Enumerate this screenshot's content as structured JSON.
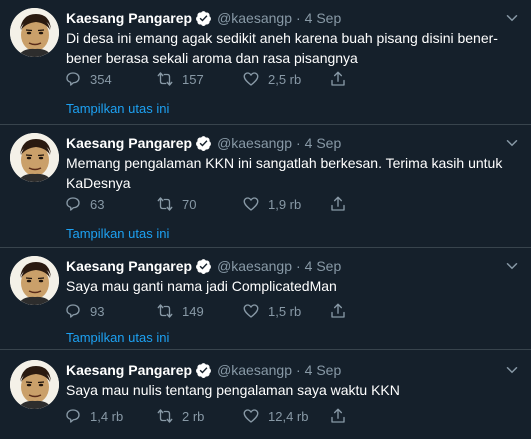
{
  "colors": {
    "background": "#15202b",
    "divider": "#38444d",
    "secondary_text": "#8899a6",
    "accent": "#1da1f2"
  },
  "tweets": [
    {
      "author": "Kaesang Pangarep",
      "handle": "@kaesangp",
      "separator": "·",
      "date": "4 Sep",
      "text": "Di desa ini emang agak sedikit aneh karena buah pisang disini bener-bener berasa sekali aroma dan rasa pisangnya",
      "replies": "354",
      "retweets": "157",
      "likes": "2,5 rb",
      "show_thread": "Tampilkan utas ini"
    },
    {
      "author": "Kaesang Pangarep",
      "handle": "@kaesangp",
      "separator": "·",
      "date": "4 Sep",
      "text": "Memang pengalaman KKN ini sangatlah berkesan. Terima kasih untuk KaDesnya",
      "replies": "63",
      "retweets": "70",
      "likes": "1,9 rb",
      "show_thread": "Tampilkan utas ini"
    },
    {
      "author": "Kaesang Pangarep",
      "handle": "@kaesangp",
      "separator": "·",
      "date": "4 Sep",
      "text": "Saya mau ganti nama jadi ComplicatedMan",
      "replies": "93",
      "retweets": "149",
      "likes": "1,5 rb",
      "show_thread": "Tampilkan utas ini"
    },
    {
      "author": "Kaesang Pangarep",
      "handle": "@kaesangp",
      "separator": "·",
      "date": "4 Sep",
      "text": "Saya mau nulis tentang pengalaman saya waktu KKN",
      "replies": "1,4 rb",
      "retweets": "2 rb",
      "likes": "12,4 rb"
    }
  ],
  "icons": {
    "verified": "verified-badge-icon",
    "more": "chevron-down-icon",
    "reply": "reply-icon",
    "retweet": "retweet-icon",
    "like": "heart-icon",
    "share": "share-icon"
  }
}
